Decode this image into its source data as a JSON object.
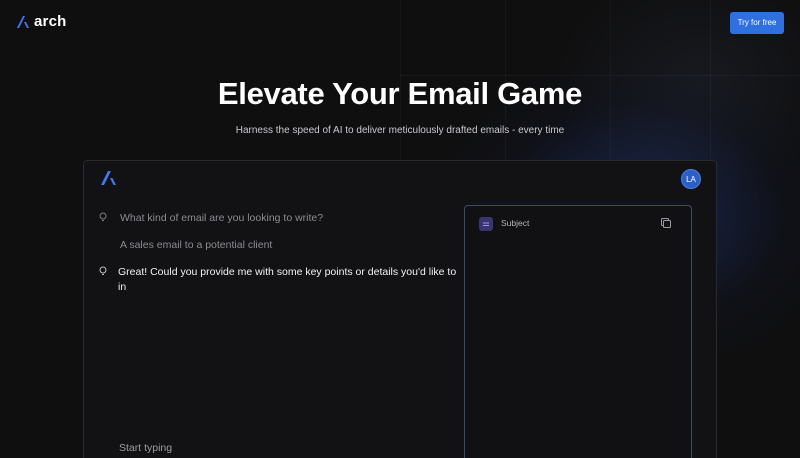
{
  "header": {
    "brand_name": "arch",
    "cta_label": "Try for free"
  },
  "hero": {
    "title": "Elevate Your Email Game",
    "subtitle": "Harness the speed of AI to deliver meticulously drafted emails - every time"
  },
  "app": {
    "avatar_initials": "LA",
    "conversation": [
      {
        "role": "assistant",
        "text": "What kind of email are you looking to write?"
      },
      {
        "role": "user",
        "text": "A sales email to a potential client"
      },
      {
        "role": "assistant",
        "text": "Great! Could you provide me with some key points or details you'd like to in"
      }
    ],
    "compose_placeholder": "Start typing",
    "panel": {
      "title": "Subject"
    }
  },
  "icons": {
    "brand": "arch-logo-icon",
    "assistant": "lightbulb-icon",
    "subject": "lines-icon",
    "copy": "copy-icon"
  },
  "colors": {
    "background": "#0f0f10",
    "accent": "#2f6fe0",
    "avatar": "#2b5fc7",
    "panel_border": "#3a4b6e"
  }
}
